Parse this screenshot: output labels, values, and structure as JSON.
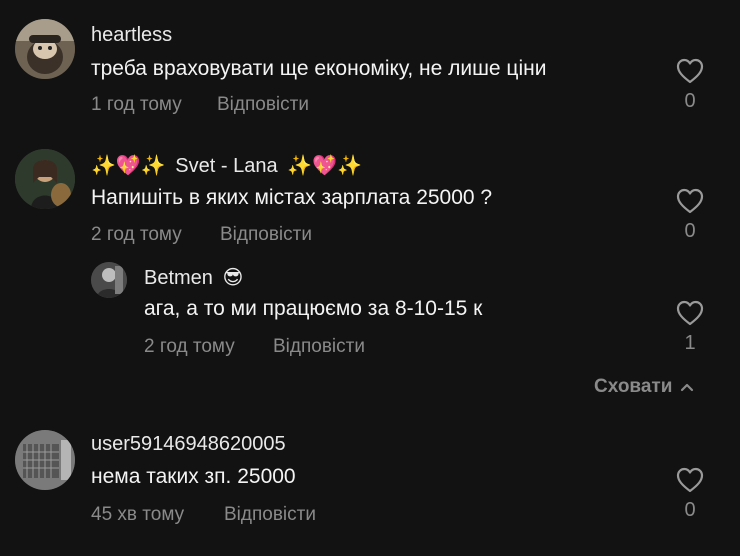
{
  "comments": [
    {
      "username": "heartless",
      "text": "треба враховувати ще економіку, не лише ціни",
      "time": "1 год тому",
      "reply_label": "Відповісти",
      "likes": "0"
    },
    {
      "username_prefix": "✨💖✨",
      "username": "Svet - Lana",
      "username_suffix": "✨💖✨",
      "text": "Напишіть в яких містах зарплата 25000 ?",
      "time": "2 год тому",
      "reply_label": "Відповісти",
      "likes": "0",
      "replies": [
        {
          "username": "Betmen",
          "username_emoji": "😎",
          "text": "ага, а то ми працюємо за 8-10-15 к",
          "time": "2 год тому",
          "reply_label": "Відповісти",
          "likes": "1"
        }
      ],
      "hide_label": "Сховати"
    },
    {
      "username": "user59146948620005",
      "text": "нема таких зп. 25000",
      "time": "45 хв тому",
      "reply_label": "Відповісти",
      "likes": "0"
    }
  ],
  "icons": {
    "like": "heart-outline-icon",
    "collapse": "chevron-up-icon"
  },
  "colors": {
    "background": "#121212",
    "text": "#f4f4f4",
    "muted": "#8a8a8a"
  }
}
